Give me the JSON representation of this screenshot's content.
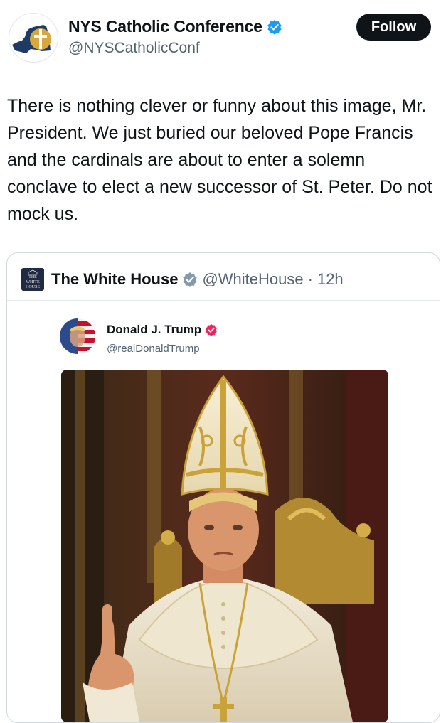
{
  "author": {
    "display_name": "NYS Catholic Conference",
    "handle": "@NYSCatholicConf",
    "verified": true,
    "avatar_icon": "ny-state-cross-logo"
  },
  "follow_label": "Follow",
  "tweet_text": "There is nothing clever or funny about this image, Mr. President. We just buried our beloved Pope Francis and the cardinals are about to enter a solemn conclave to elect a new successor of St. Peter. Do not mock us.",
  "quoted": {
    "logo_text": "THE WHITE HOUSE",
    "display_name": "The White House",
    "handle": "@WhiteHouse",
    "separator": "·",
    "time": "12h",
    "verified_type": "gray",
    "inner_post": {
      "display_name": "Donald J. Trump",
      "handle": "@realDonaldTrump",
      "verified_type": "red",
      "image_icon": "pope-portrait-image"
    }
  },
  "colors": {
    "text_primary": "#0f1419",
    "text_secondary": "#536471",
    "verified_blue": "#1d9bf0",
    "verified_gray": "#829aab",
    "verified_red": "#f4215f",
    "border": "#cfd9de"
  }
}
